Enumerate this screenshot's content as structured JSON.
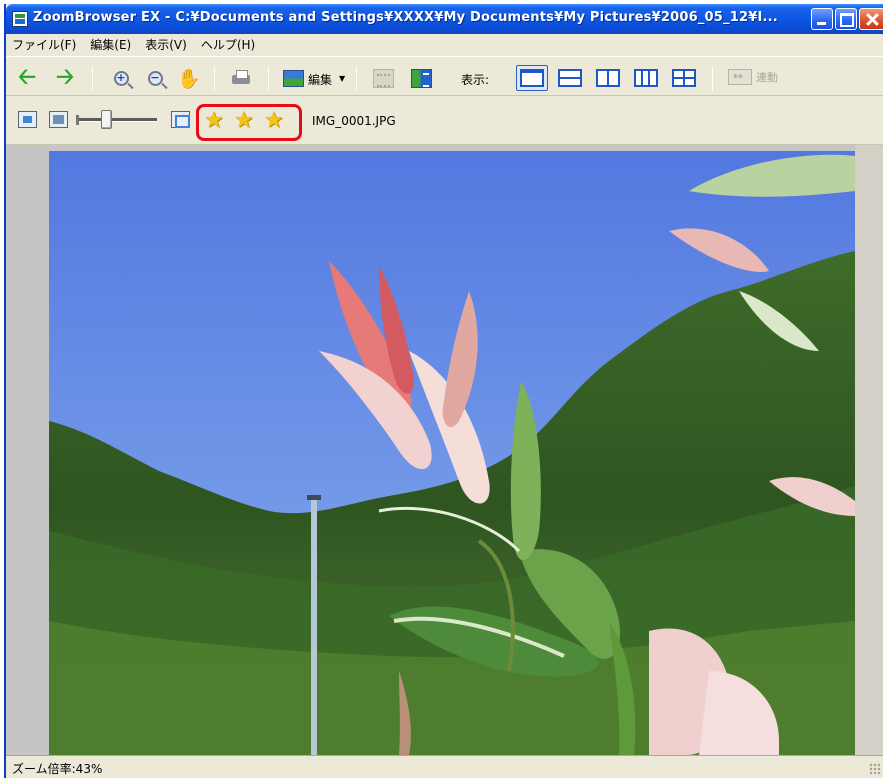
{
  "window": {
    "title": "ZoomBrowser EX - C:¥Documents and Settings¥XXXX¥My Documents¥My Pictures¥2006_05_12¥I..."
  },
  "menu": {
    "items": [
      "ファイル(F)",
      "編集(E)",
      "表示(V)",
      "ヘルプ(H)"
    ]
  },
  "toolbar": {
    "zoom_in": "+",
    "edit_label": "編集",
    "display_label": "表示:",
    "sync_label": "連動"
  },
  "image_bar": {
    "rating_stars": 3,
    "filename": "IMG_0001.JPG"
  },
  "status": {
    "zoom_text": "ズーム倍率:43%"
  },
  "colors": {
    "accent": "#0a4ad4",
    "highlight_box": "#e30d13",
    "star": "#f2c517"
  },
  "icons": [
    "back-arrow-icon",
    "forward-arrow-icon",
    "zoom-in-icon",
    "zoom-out-icon",
    "hand-icon",
    "printer-icon",
    "edit-image-icon",
    "info-icon",
    "single-view-icon",
    "horizontal-split-icon",
    "vertical-split-icon",
    "three-column-icon",
    "quad-view-icon",
    "sync-icon",
    "fit-window-icon",
    "actual-size-icon",
    "frame-icon",
    "star-icon"
  ]
}
